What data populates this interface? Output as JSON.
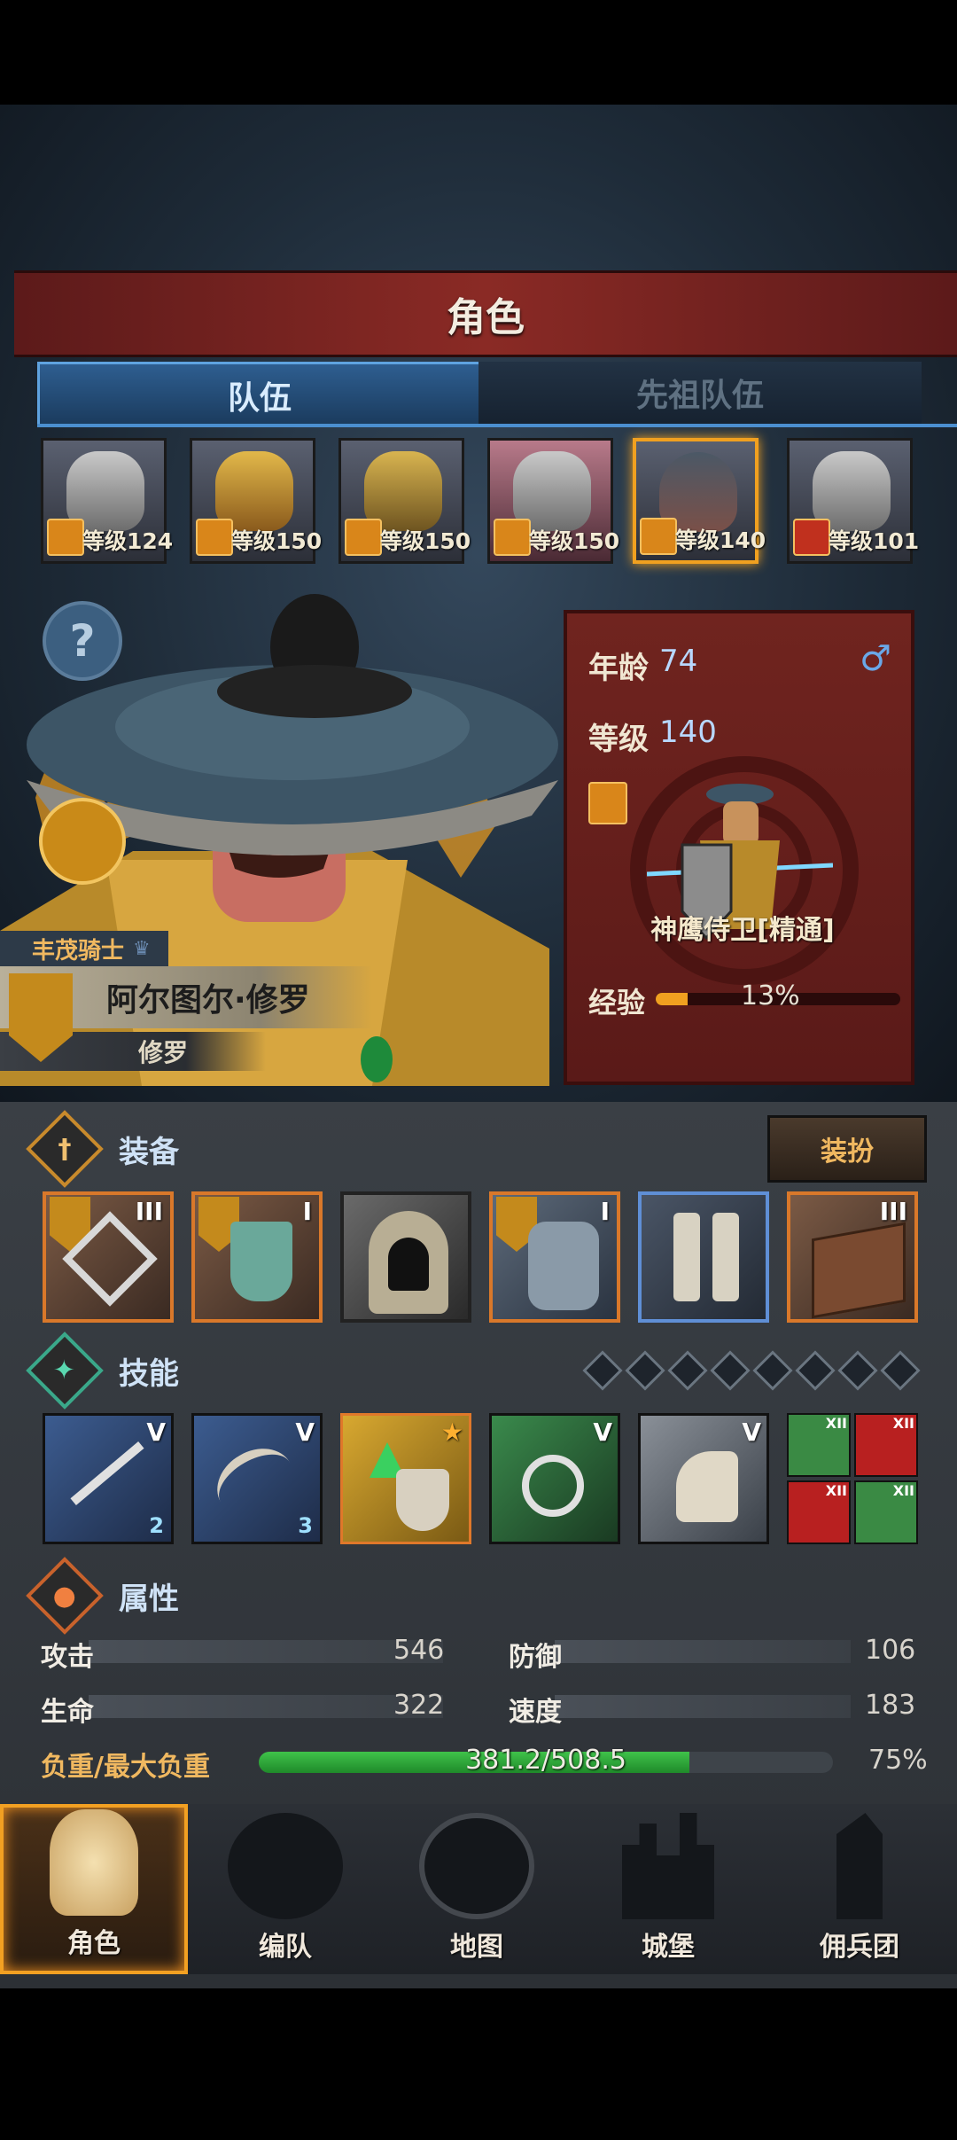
{
  "header": {
    "title": "角色"
  },
  "tabs": [
    {
      "label": "队伍",
      "active": true
    },
    {
      "label": "先祖队伍",
      "active": false
    }
  ],
  "team": [
    {
      "level_text": "等级124",
      "selected": false
    },
    {
      "level_text": "等级150",
      "selected": false
    },
    {
      "level_text": "等级150",
      "selected": false
    },
    {
      "level_text": "等级150",
      "selected": false
    },
    {
      "level_text": "等级140",
      "selected": true
    },
    {
      "level_text": "等级101",
      "selected": false
    }
  ],
  "help": {
    "symbol": "?"
  },
  "character": {
    "title": "丰茂骑士",
    "name": "阿尔图尔·修罗",
    "subname": "修罗"
  },
  "info": {
    "age_label": "年龄",
    "age_value": "74",
    "gender_symbol": "♂",
    "level_label": "等级",
    "level_value": "140",
    "class_name": "神鹰侍卫[精通]",
    "exp_label": "经验",
    "exp_value": "13%",
    "exp_fraction": 0.13
  },
  "equipment": {
    "title": "装备",
    "dress_button": "装扮",
    "items": [
      {
        "tier": "III",
        "rarity": "orange",
        "crest": true,
        "icon": "crossguard-icon"
      },
      {
        "tier": "I",
        "rarity": "orange",
        "crest": true,
        "icon": "shield-icon"
      },
      {
        "tier": "",
        "rarity": "gray",
        "crest": false,
        "icon": "hood-icon"
      },
      {
        "tier": "I",
        "rarity": "orange",
        "crest": true,
        "icon": "armor-icon"
      },
      {
        "tier": "",
        "rarity": "blue",
        "crest": false,
        "icon": "boots-icon"
      },
      {
        "tier": "III",
        "rarity": "orange",
        "crest": false,
        "icon": "book-icon"
      }
    ]
  },
  "skills": {
    "title": "技能",
    "slots_empty": 8,
    "items": [
      {
        "tier": "V",
        "count": "2",
        "color": "#2d4a78"
      },
      {
        "tier": "V",
        "count": "3",
        "color": "#2d4a78"
      },
      {
        "tier": "★",
        "count": "",
        "color": "#b88a1c"
      },
      {
        "tier": "V",
        "count": "",
        "color": "#2f6a3c"
      },
      {
        "tier": "V",
        "count": "",
        "color": "#5a6068"
      }
    ],
    "mini": [
      {
        "tier": "XII",
        "color": "#3a8a44"
      },
      {
        "tier": "XII",
        "color": "#b82020"
      },
      {
        "tier": "XII",
        "color": "#b82020"
      },
      {
        "tier": "XII",
        "color": "#3a8a44"
      }
    ]
  },
  "attributes": {
    "title": "属性",
    "attack_label": "攻击",
    "attack_value": "546",
    "defense_label": "防御",
    "defense_value": "106",
    "hp_label": "生命",
    "hp_value": "322",
    "speed_label": "速度",
    "speed_value": "183",
    "load_label": "负重/最大负重",
    "load_value": "381.2/508.5",
    "load_percent": "75%",
    "load_fraction": 0.75
  },
  "nav": [
    {
      "label": "角色",
      "active": true
    },
    {
      "label": "编队",
      "active": false
    },
    {
      "label": "地图",
      "active": false
    },
    {
      "label": "城堡",
      "active": false
    },
    {
      "label": "佣兵团",
      "active": false
    }
  ],
  "colors": {
    "accent": "#f0a020",
    "tab_active": "#2e5e90",
    "banner": "#8a2a25",
    "load_bar": "#3fc24a"
  }
}
